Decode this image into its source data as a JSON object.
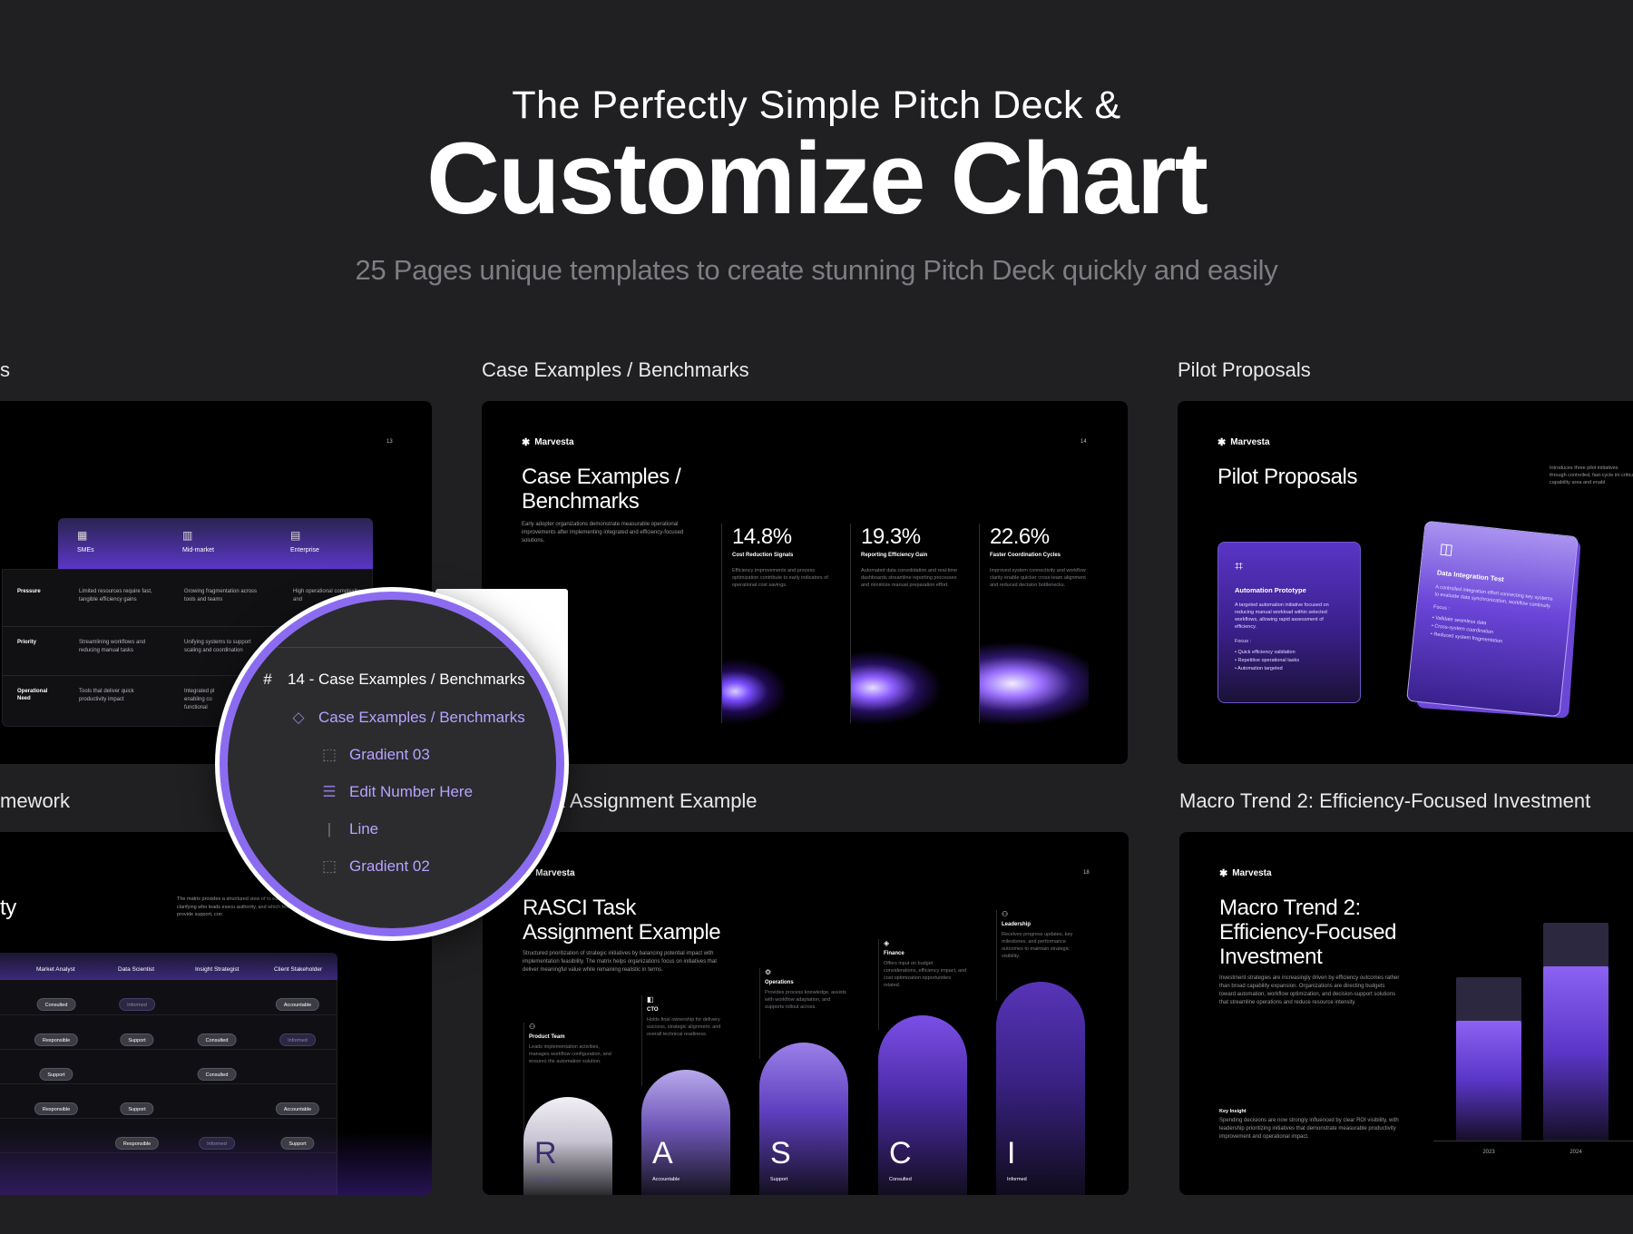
{
  "hero": {
    "line1": "The Perfectly Simple Pitch Deck &",
    "title": "Customize Chart",
    "subtitle": "25 Pages unique templates to create stunning Pitch Deck quickly and easily"
  },
  "section_labels": {
    "top_left": "s",
    "top_middle": "Case Examples / Benchmarks",
    "top_right": "Pilot Proposals",
    "bottom_left": "mework",
    "bottom_middle": "k Assignment Example",
    "bottom_right": "Macro Trend 2: Efficiency-Focused Investment"
  },
  "brand": "Marvesta",
  "slide1": {
    "page": "13",
    "columns": [
      "SMEs",
      "Mid-market",
      "Enterprise"
    ],
    "rows": [
      {
        "label": "Pressure",
        "cells": [
          "Limited resources require fast, tangible efficiency gains",
          "Growing fragmentation across tools and teams",
          "High operational complexity and"
        ]
      },
      {
        "label": "Priority",
        "cells": [
          "Streamlining workflows and reducing manual tasks",
          "Unifying systems to support scaling and coordination",
          ""
        ]
      },
      {
        "label": "Operational Need",
        "cells": [
          "Tools that deliver quick productivity impact",
          "Integrated pl enabling co functional",
          ""
        ]
      }
    ]
  },
  "slide2": {
    "page": "14",
    "title": "Case Examples / Benchmarks",
    "desc": "Early adopter organizations demonstrate measurable operational improvements after implementing integrated and efficiency-focused solutions.",
    "metrics": [
      {
        "value": "14.8%",
        "label": "Cost Reduction Signals",
        "text": "Efficiency improvements and process optimization contribute to early indicators of operational cost savings."
      },
      {
        "value": "19.3%",
        "label": "Reporting Efficiency Gain",
        "text": "Automated data consolidation and real-time dashboards streamline reporting processes and minimize manual preparation effort."
      },
      {
        "value": "22.6%",
        "label": "Faster Coordination Cycles",
        "text": "Improved system connectivity and workflow clarity enable quicker cross-team alignment and reduced decision bottlenecks."
      }
    ]
  },
  "slide3": {
    "title": "Pilot Proposals",
    "desc": "Introduces three pilot initiatives through controlled, fast-cycle im critical capability area and enabl",
    "cards": [
      {
        "title": "Automation Prototype",
        "text": "A targeted automation initiative focused on reducing manual workload within selected workflows, allowing rapid assessment of efficiency.",
        "focus": "Focus :",
        "items": [
          "Quick efficiency validation",
          "Repetitive operational tasks",
          "Automation targeted"
        ]
      },
      {
        "title": "Data Integration Test",
        "text": "A controlled integration effort connecting key systems to evaluate data synchronization, workflow continuity",
        "focus": "Focus :",
        "items": [
          "Validate seamless data",
          "Cross-system coordination",
          "Reduced system fragmentation"
        ]
      }
    ]
  },
  "slide4": {
    "title": "ty",
    "desc": "The matrix provides a structured view of to each initiative—clarifying who leads execu authority, and which teams provide support, con",
    "columns": [
      "Market Analyst",
      "Data Scientist",
      "Insight Strategist",
      "Client Stakeholder"
    ],
    "rows": [
      [
        "Consulted",
        "Informed",
        "",
        "Accountable"
      ],
      [
        "Responsible",
        "Support",
        "Consulted",
        "Informed"
      ],
      [
        "Support",
        "",
        "Consulted",
        ""
      ],
      [
        "Responsible",
        "Support",
        "",
        "Accountable"
      ],
      [
        "",
        "Responsible",
        "Informed",
        "Support"
      ]
    ]
  },
  "slide5": {
    "page": "18",
    "title": "RASCI Task Assignment Example",
    "desc": "Structured prioritization of strategic initiatives by balancing potential impact with implementation feasibility. The matrix helps organizations focus on initiatives that deliver meaningful value while remaining realistic in terms.",
    "columns": [
      {
        "letter": "R",
        "sub": "Responsible",
        "role": "Product Team",
        "text": "Leads implementation activities, manages workflow configuration, and ensures the automation solution."
      },
      {
        "letter": "A",
        "sub": "Accountable",
        "role": "CTO",
        "text": "Holds final ownership for delivery success, strategic alignment, and overall technical readiness."
      },
      {
        "letter": "S",
        "sub": "Support",
        "role": "Operations",
        "text": "Provides process knowledge, assists with workflow adaptation, and supports rollout across."
      },
      {
        "letter": "C",
        "sub": "Consulted",
        "role": "Finance",
        "text": "Offers input on budget considerations, efficiency impact, and cost optimization opportunities related."
      },
      {
        "letter": "I",
        "sub": "Informed",
        "role": "Leadership",
        "text": "Receives progress updates, key milestones, and performance outcomes to maintain strategic visibility."
      }
    ]
  },
  "slide6": {
    "title": "Macro Trend 2: Efficiency-Focused Investment",
    "desc": "Investment strategies are increasingly driven by efficiency outcomes rather than broad capability expansion. Organizations are directing budgets toward automation, workflow optimization, and decision-support solutions that streamline operations and reduce resource intensity.",
    "insight_title": "Key Insight",
    "insight": "Spending decisions are now strongly influenced by clear ROI visibility, with leadership prioritizing initiatives that demonstrate measurable productivity improvement and operational impact."
  },
  "chart_data": {
    "type": "bar",
    "categories": [
      "2023",
      "2024"
    ],
    "series": [
      {
        "values": [
          0.55,
          0.8
        ]
      },
      {
        "values": [
          0.75,
          1.0
        ]
      }
    ]
  },
  "layers_panel": {
    "frame": "14 - Case Examples / Benchmarks",
    "items": [
      {
        "label": "Case Examples / Benchmarks",
        "icon": "component-icon"
      },
      {
        "label": "Gradient 03",
        "icon": "frame-icon"
      },
      {
        "label": "Edit Number Here",
        "icon": "autolayout-icon"
      },
      {
        "label": "Line",
        "icon": "line-icon"
      },
      {
        "label": "Gradient 02",
        "icon": "frame-icon"
      }
    ],
    "accent": "#8b6cf0"
  },
  "colors": {
    "background": "#202022",
    "purple": "#6a42d8",
    "slide": "#000000"
  }
}
